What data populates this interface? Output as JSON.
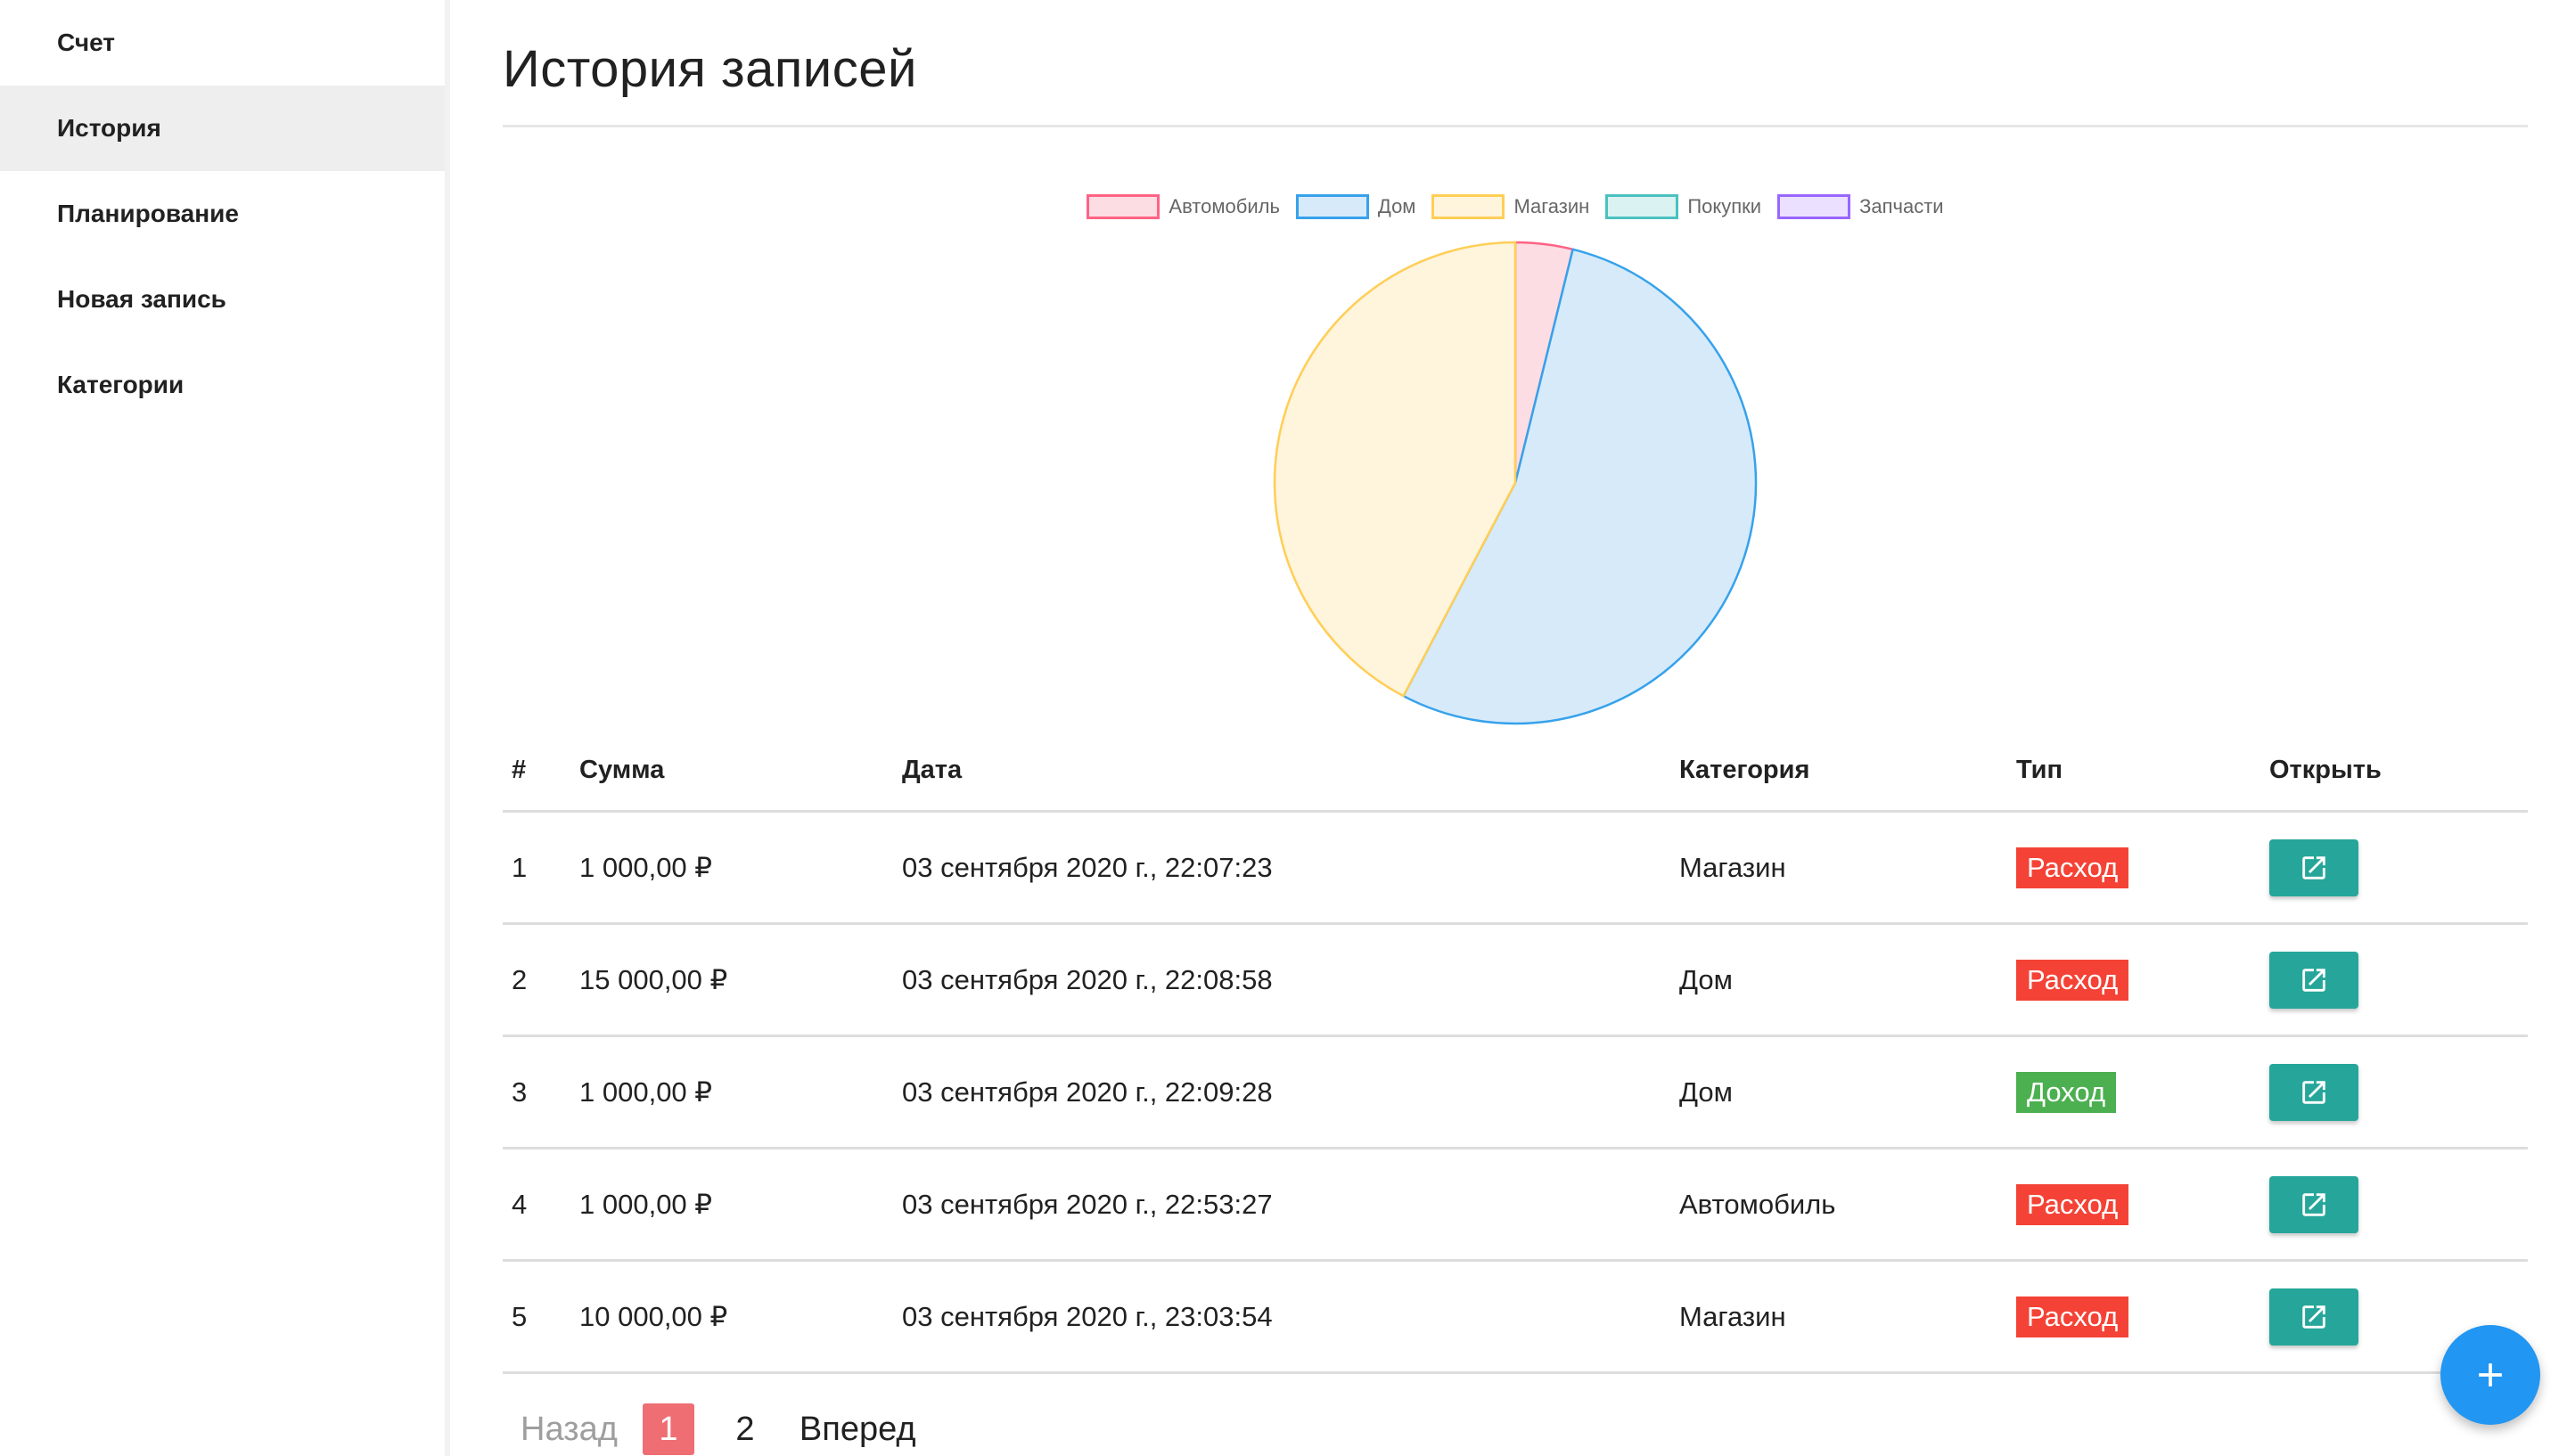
{
  "sidebar": {
    "items": [
      {
        "label": "Счет",
        "active": false
      },
      {
        "label": "История",
        "active": true
      },
      {
        "label": "Планирование",
        "active": false
      },
      {
        "label": "Новая запись",
        "active": false
      },
      {
        "label": "Категории",
        "active": false
      }
    ]
  },
  "page": {
    "title": "История записей"
  },
  "chart_data": {
    "type": "pie",
    "legend_position": "top",
    "categories": [
      "Автомобиль",
      "Дом",
      "Магазин",
      "Покупки",
      "Запчасти"
    ],
    "values": [
      1000,
      14000,
      11000,
      0,
      0
    ],
    "colors": {
      "fill": [
        "#fcdde4",
        "#d7eafa",
        "#fff4dc",
        "#dbf2f2",
        "#ebe0ff"
      ],
      "border": [
        "#ff6384",
        "#36a2eb",
        "#ffce56",
        "#4bc0c0",
        "#9966ff"
      ]
    }
  },
  "table": {
    "headers": {
      "num": "#",
      "sum": "Сумма",
      "date": "Дата",
      "category": "Категория",
      "type": "Тип",
      "open": "Открыть"
    },
    "rows": [
      {
        "num": "1",
        "sum": "1 000,00 ₽",
        "date": "03 сентября 2020 г., 22:07:23",
        "category": "Магазин",
        "type": "Расход",
        "type_color": "#f44336"
      },
      {
        "num": "2",
        "sum": "15 000,00 ₽",
        "date": "03 сентября 2020 г., 22:08:58",
        "category": "Дом",
        "type": "Расход",
        "type_color": "#f44336"
      },
      {
        "num": "3",
        "sum": "1 000,00 ₽",
        "date": "03 сентября 2020 г., 22:09:28",
        "category": "Дом",
        "type": "Доход",
        "type_color": "#4caf50"
      },
      {
        "num": "4",
        "sum": "1 000,00 ₽",
        "date": "03 сентября 2020 г., 22:53:27",
        "category": "Автомобиль",
        "type": "Расход",
        "type_color": "#f44336"
      },
      {
        "num": "5",
        "sum": "10 000,00 ₽",
        "date": "03 сентября 2020 г., 23:03:54",
        "category": "Магазин",
        "type": "Расход",
        "type_color": "#f44336"
      }
    ],
    "open_icon": "open-in-new-icon"
  },
  "pagination": {
    "prev_label": "Назад",
    "pages": [
      "1",
      "2"
    ],
    "active_page": "1",
    "next_label": "Вперед"
  },
  "fab": {
    "icon": "plus-icon",
    "label": "+",
    "color": "#2196f3"
  }
}
